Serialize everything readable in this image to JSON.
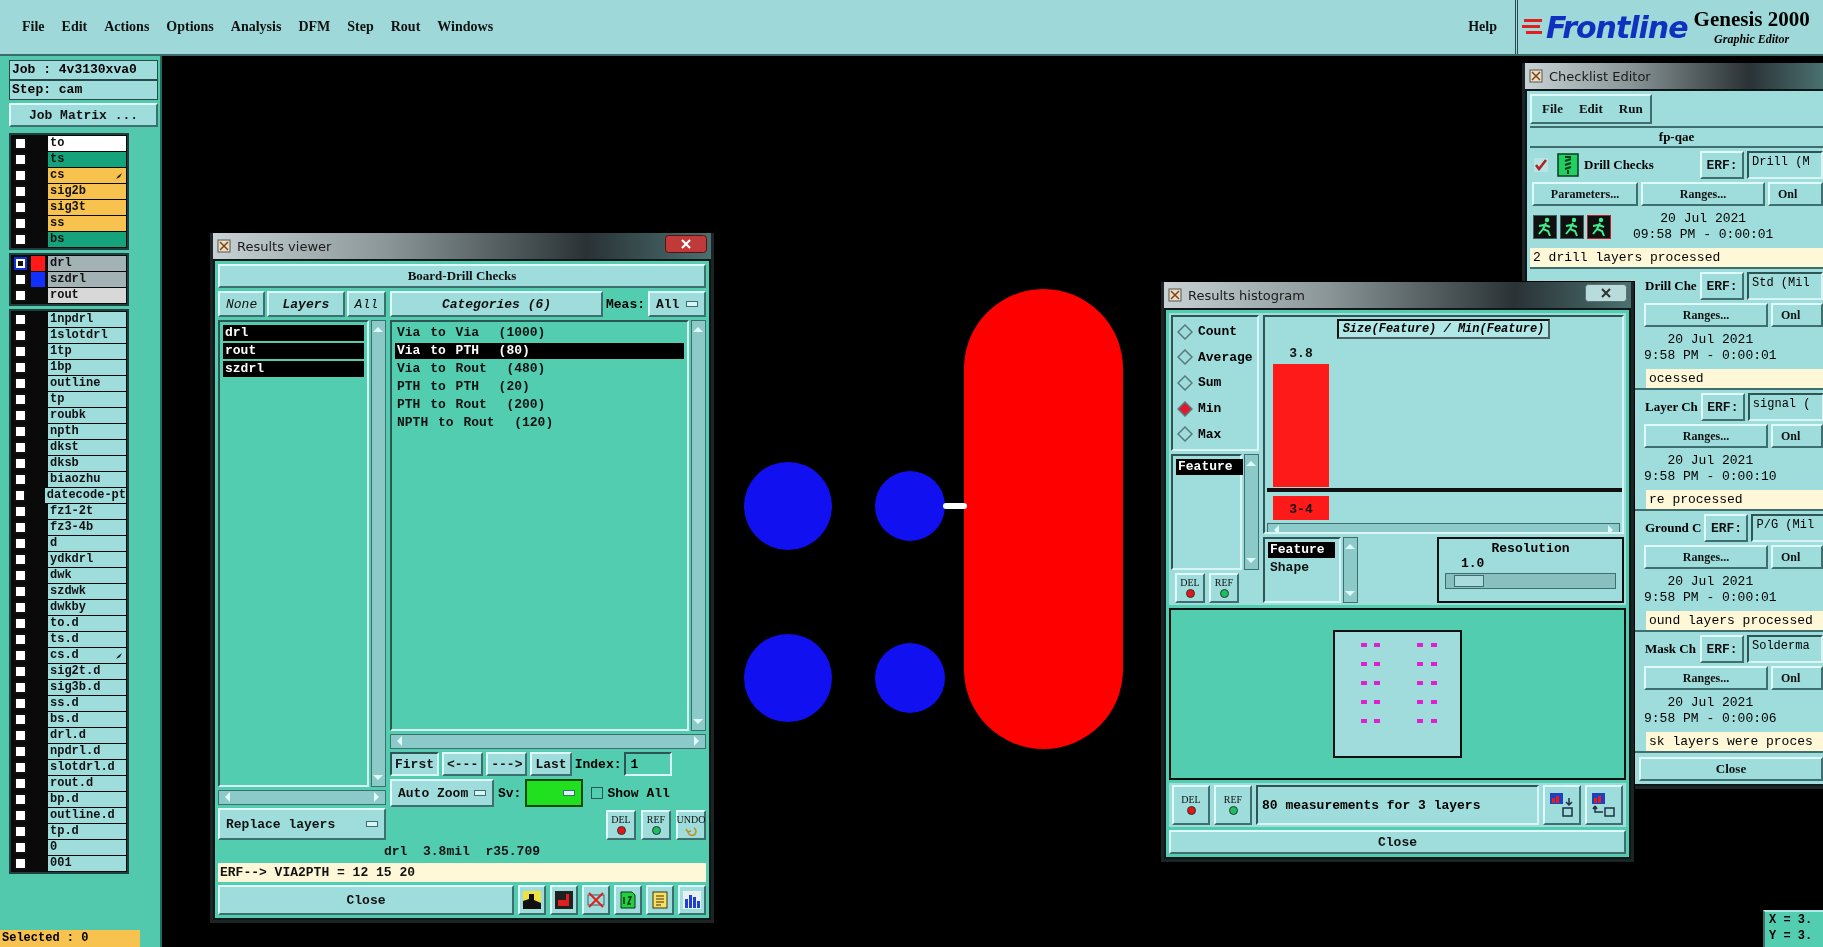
{
  "menu_bar": {
    "items": [
      "File",
      "Edit",
      "Actions",
      "Options",
      "Analysis",
      "DFM",
      "Step",
      "Rout",
      "Windows"
    ],
    "help": "Help"
  },
  "logo": {
    "brand": "Frontline",
    "product": "Genesis 2000",
    "subtitle": "Graphic Editor"
  },
  "job_panel": {
    "job": "Job : 4v3130xva0",
    "step": "Step: cam",
    "matrix_button": "Job Matrix ...",
    "layer_groups": [
      [
        {
          "name": "to",
          "color": "#ffffff",
          "selected": false,
          "marked": false
        },
        {
          "name": "ts",
          "color": "#14a37a",
          "selected": false,
          "marked": false
        },
        {
          "name": "cs",
          "color": "#f7c24e",
          "selected": false,
          "marked": true
        },
        {
          "name": "sig2b",
          "color": "#f7c24e",
          "selected": false,
          "marked": false
        },
        {
          "name": "sig3t",
          "color": "#f7c24e",
          "selected": false,
          "marked": false
        },
        {
          "name": "ss",
          "color": "#f7c24e",
          "selected": false,
          "marked": false
        },
        {
          "name": "bs",
          "color": "#14a37a",
          "selected": false,
          "marked": false
        }
      ],
      [
        {
          "name": "drl",
          "color": "#a3b2b4",
          "swatch": {
            "color": "#ff1a1a"
          },
          "selected": true,
          "marked": false
        },
        {
          "name": "szdrl",
          "color": "#a3b2b4",
          "swatch": {
            "color": "#1030ff"
          },
          "selected": false,
          "marked": false
        },
        {
          "name": "rout",
          "color": "#d8d8d8",
          "selected": false,
          "marked": false
        }
      ],
      [
        {
          "name": "1npdrl",
          "color": "#9fdcdc",
          "selected": false,
          "marked": false
        },
        {
          "name": "1slotdrl",
          "color": "#9fdcdc",
          "selected": false,
          "marked": false
        },
        {
          "name": "1tp",
          "color": "#9fdcdc",
          "selected": false,
          "marked": false
        },
        {
          "name": "1bp",
          "color": "#9fdcdc",
          "selected": false,
          "marked": false
        },
        {
          "name": "outline",
          "color": "#9fdcdc",
          "selected": false,
          "marked": false
        },
        {
          "name": "tp",
          "color": "#9fdcdc",
          "selected": false,
          "marked": false
        },
        {
          "name": "roubk",
          "color": "#9fdcdc",
          "selected": false,
          "marked": false
        },
        {
          "name": "npth",
          "color": "#9fdcdc",
          "selected": false,
          "marked": false
        },
        {
          "name": "dkst",
          "color": "#9fdcdc",
          "selected": false,
          "marked": false
        },
        {
          "name": "dksb",
          "color": "#9fdcdc",
          "selected": false,
          "marked": false
        },
        {
          "name": "biaozhu",
          "color": "#9fdcdc",
          "selected": false,
          "marked": false
        },
        {
          "name": "datecode-pt",
          "color": "#9fdcdc",
          "selected": false,
          "marked": false
        },
        {
          "name": "fz1-2t",
          "color": "#9fdcdc",
          "selected": false,
          "marked": false
        },
        {
          "name": "fz3-4b",
          "color": "#9fdcdc",
          "selected": false,
          "marked": false
        },
        {
          "name": "d",
          "color": "#9fdcdc",
          "selected": false,
          "marked": false
        },
        {
          "name": "ydkdrl",
          "color": "#9fdcdc",
          "selected": false,
          "marked": false
        },
        {
          "name": "dwk",
          "color": "#9fdcdc",
          "selected": false,
          "marked": false
        },
        {
          "name": "szdwk",
          "color": "#9fdcdc",
          "selected": false,
          "marked": false
        },
        {
          "name": "dwkby",
          "color": "#9fdcdc",
          "selected": false,
          "marked": false
        },
        {
          "name": "to.d",
          "color": "#9fdcdc",
          "selected": false,
          "marked": false
        },
        {
          "name": "ts.d",
          "color": "#9fdcdc",
          "selected": false,
          "marked": false
        },
        {
          "name": "cs.d",
          "color": "#9fdcdc",
          "selected": false,
          "marked": true
        },
        {
          "name": "sig2t.d",
          "color": "#9fdcdc",
          "selected": false,
          "marked": false
        },
        {
          "name": "sig3b.d",
          "color": "#9fdcdc",
          "selected": false,
          "marked": false
        },
        {
          "name": "ss.d",
          "color": "#9fdcdc",
          "selected": false,
          "marked": false
        },
        {
          "name": "bs.d",
          "color": "#9fdcdc",
          "selected": false,
          "marked": false
        },
        {
          "name": "drl.d",
          "color": "#9fdcdc",
          "selected": false,
          "marked": false
        },
        {
          "name": "npdrl.d",
          "color": "#9fdcdc",
          "selected": false,
          "marked": false
        },
        {
          "name": "slotdrl.d",
          "color": "#9fdcdc",
          "selected": false,
          "marked": false
        },
        {
          "name": "rout.d",
          "color": "#9fdcdc",
          "selected": false,
          "marked": false
        },
        {
          "name": "bp.d",
          "color": "#9fdcdc",
          "selected": false,
          "marked": false
        },
        {
          "name": "outline.d",
          "color": "#9fdcdc",
          "selected": false,
          "marked": false
        },
        {
          "name": "tp.d",
          "color": "#9fdcdc",
          "selected": false,
          "marked": false
        },
        {
          "name": "0",
          "color": "#9fdcdc",
          "selected": false,
          "marked": false
        },
        {
          "name": "001",
          "color": "#9fdcdc",
          "selected": false,
          "marked": false
        }
      ]
    ],
    "selected_count": "Selected : 0"
  },
  "results_viewer": {
    "title": "Results viewer",
    "heading": "Board-Drill Checks",
    "layer_filter": {
      "none": "None",
      "title": "Layers",
      "all": "All"
    },
    "layers": [
      {
        "name": "drl",
        "selected": true
      },
      {
        "name": "rout",
        "selected": true
      },
      {
        "name": "szdrl",
        "selected": true
      }
    ],
    "categories_button": "Categories (6)",
    "meas_label": "Meas:",
    "meas_value": "All",
    "categories": [
      {
        "label": "Via to Via  (1000)",
        "selected": false
      },
      {
        "label": "Via to PTH  (80)",
        "selected": true
      },
      {
        "label": "Via to Rout  (480)",
        "selected": false
      },
      {
        "label": "PTH to PTH  (20)",
        "selected": false
      },
      {
        "label": "PTH to Rout  (200)",
        "selected": false
      },
      {
        "label": "NPTH to Rout  (120)",
        "selected": false
      }
    ],
    "nav_buttons": [
      {
        "label": "First",
        "selected": true
      },
      {
        "label": "<---",
        "selected": false
      },
      {
        "label": "--->",
        "selected": false
      },
      {
        "label": "Last",
        "selected": false
      }
    ],
    "index_label": "Index:",
    "index_value": "1",
    "auto_zoom": "Auto Zoom",
    "sv_label": "Sv:",
    "show_all": {
      "label": "Show All",
      "checked": false
    },
    "replace_layers": "Replace layers",
    "tool_buttons": [
      {
        "label": "DEL",
        "kind": "del"
      },
      {
        "label": "REF",
        "kind": "ref"
      },
      {
        "label": "UNDO",
        "kind": "undo"
      }
    ],
    "status": "drl  3.8mil  r35.709",
    "erf_line": "ERF--> VIA2PTH = 12 15 20",
    "close": "Close"
  },
  "checklist_editor": {
    "title": "Checklist Editor",
    "menu": [
      "File",
      "Edit",
      "Run"
    ],
    "name": "fp-qae",
    "checks": [
      {
        "kind": "full",
        "checked": true,
        "name": "Drill Checks",
        "erf_label": "ERF:",
        "erf_value": "Drill (M",
        "parameters": "Parameters...",
        "ranges": "Ranges...",
        "only": "Onl",
        "date": "20 Jul 2021",
        "time": "09:58 PM - 0:00:01",
        "message": "2 drill layers processed"
      },
      {
        "kind": "partial",
        "name": "Drill Che",
        "erf_label": "ERF:",
        "erf_value": "Std (Mil",
        "ranges": "Ranges...",
        "only": "Onl",
        "date": "20 Jul 2021",
        "time": "9:58 PM - 0:00:01",
        "message": "ocessed"
      },
      {
        "kind": "partial",
        "name": "Layer Ch",
        "erf_label": "ERF:",
        "erf_value": "signal (",
        "ranges": "Ranges...",
        "only": "Onl",
        "date": "20 Jul 2021",
        "time": "9:58 PM - 0:00:10",
        "message": "re processed"
      },
      {
        "kind": "partial",
        "name": "Ground C",
        "erf_label": "ERF:",
        "erf_value": "P/G (Mil",
        "ranges": "Ranges...",
        "only": "Onl",
        "date": "20 Jul 2021",
        "time": "9:58 PM - 0:00:01",
        "message": "ound layers processed"
      },
      {
        "kind": "partial",
        "name": "Mask Ch",
        "erf_label": "ERF:",
        "erf_value": "Solderma",
        "ranges": "Ranges...",
        "only": "Onl",
        "date": "20 Jul 2021",
        "time": "9:58 PM - 0:00:06",
        "message": "sk layers were proces"
      }
    ],
    "close": "Close"
  },
  "results_histogram": {
    "title": "Results histogram",
    "measures": [
      {
        "label": "Count",
        "selected": false
      },
      {
        "label": "Average",
        "selected": false
      },
      {
        "label": "Sum",
        "selected": false
      },
      {
        "label": "Min",
        "selected": true
      },
      {
        "label": "Max",
        "selected": false
      }
    ],
    "feature_list": [
      {
        "label": "Feature",
        "selected": true
      }
    ],
    "tool_buttons": [
      {
        "label": "DEL",
        "kind": "del"
      },
      {
        "label": "REF",
        "kind": "ref"
      }
    ],
    "histogram": {
      "title": "Size(Feature) / Min(Feature)",
      "bars": [
        {
          "value_label": "3.8",
          "bin_label": "3-4"
        }
      ]
    },
    "group_list": [
      {
        "label": "Feature",
        "selected": true
      },
      {
        "label": "Shape",
        "selected": false
      }
    ],
    "resolution_label": "Resolution",
    "resolution_value": "1.0",
    "resolution": {
      "level": 0.05
    },
    "footer_buttons": [
      {
        "label": "DEL",
        "kind": "del"
      },
      {
        "label": "REF",
        "kind": "ref"
      }
    ],
    "summary": "80 measurements for 3 layers",
    "close": "Close"
  },
  "coordinates": {
    "x": "X = 3.",
    "y": "Y = 3."
  }
}
